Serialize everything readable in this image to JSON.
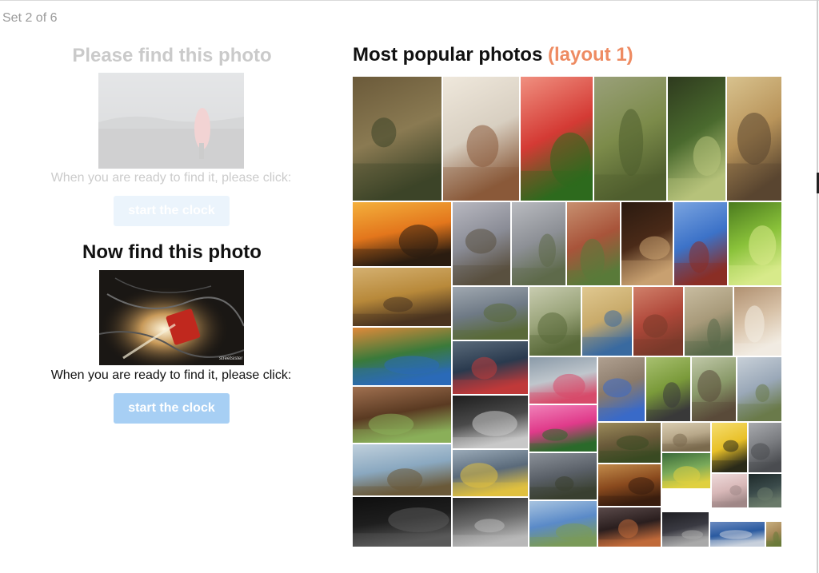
{
  "header": {
    "set_label": "Set 2 of 6"
  },
  "previous_target": {
    "heading": "Please find this photo",
    "instruction": "When you are ready to find it, please click:",
    "button_label": "start the clock",
    "image": "photo-misty-lake-silhouette"
  },
  "current_target": {
    "heading": "Now find this photo",
    "instruction": "When you are ready to find it, please click:",
    "button_label": "start the clock",
    "image": "photo-firefighters-night-scene",
    "watermark": "streetsister"
  },
  "gallery": {
    "title": "Most popular photos",
    "layout_label": "(layout 1)",
    "accent_color": "#ee8b62",
    "photos": [
      {
        "name": "tree-reflection-lake",
        "c1": "#8a7a52",
        "c2": "#3d4428",
        "c3": "#6b5a3a"
      },
      {
        "name": "woman-holding-hare",
        "c1": "#d8cfc1",
        "c2": "#8a5a3a",
        "c3": "#efe8dc"
      },
      {
        "name": "red-dahlia-flower",
        "c1": "#d43a34",
        "c2": "#2d6a1e",
        "c3": "#f09080"
      },
      {
        "name": "green-mountain-valley",
        "c1": "#7c8b4a",
        "c2": "#4f5e2e",
        "c3": "#9aa07a"
      },
      {
        "name": "palm-fronds-sky",
        "c1": "#4a6a2e",
        "c2": "#b6c27a",
        "c3": "#2e3a1e"
      },
      {
        "name": "sparrow-on-straw",
        "c1": "#b9945a",
        "c2": "#5a4630",
        "c3": "#d8c28e"
      },
      {
        "name": "sunset-gazebo",
        "c1": "#e3761c",
        "c2": "#2a1c10",
        "c3": "#f4b03c"
      },
      {
        "name": "beach-evening-people",
        "c1": "#8a8c96",
        "c2": "#5a5040",
        "c3": "#b8b8c0"
      },
      {
        "name": "grey-mountains-haze",
        "c1": "#8d9096",
        "c2": "#5e6a4a",
        "c3": "#b9bbc0"
      },
      {
        "name": "red-canyon-landscape",
        "c1": "#a8543a",
        "c2": "#5a7a3a",
        "c3": "#c79070"
      },
      {
        "name": "latte-art-coffee",
        "c1": "#4a2a18",
        "c2": "#c8a070",
        "c3": "#2a1a10"
      },
      {
        "name": "red-barn-blue-sky",
        "c1": "#3c72c8",
        "c2": "#8a2e26",
        "c3": "#7aa4e0"
      },
      {
        "name": "green-orchid",
        "c1": "#8ac23a",
        "c2": "#d8ea8a",
        "c3": "#4a7a1e"
      },
      {
        "name": "deer-in-grass",
        "c1": "#b8893a",
        "c2": "#4a3420",
        "c3": "#d4b070"
      },
      {
        "name": "castle-ruin-clouds",
        "c1": "#6f7a86",
        "c2": "#5a6a3a",
        "c3": "#a0a8b0"
      },
      {
        "name": "olive-trees-path",
        "c1": "#9aa47a",
        "c2": "#5a6a3a",
        "c3": "#c8ccb0"
      },
      {
        "name": "cafe-square-domes",
        "c1": "#c8aa6a",
        "c2": "#3a6aa0",
        "c3": "#e0c890"
      },
      {
        "name": "red-building-facade",
        "c1": "#b0483a",
        "c2": "#7a3a2a",
        "c3": "#d0806a"
      },
      {
        "name": "statue-garden-sepia",
        "c1": "#a89a7a",
        "c2": "#5a6a4a",
        "c3": "#c8bca0"
      },
      {
        "name": "glass-of-milk",
        "c1": "#d8c2a8",
        "c2": "#f2ece2",
        "c3": "#b09070"
      },
      {
        "name": "kingfisher-bird",
        "c1": "#3a7a3a",
        "c2": "#2a6ab8",
        "c3": "#e08a3a"
      },
      {
        "name": "light-painting-beach",
        "c1": "#2a3a4e",
        "c2": "#c03a3a",
        "c3": "#5a6a7a"
      },
      {
        "name": "pink-flamingos-flight",
        "c1": "#bfc6cc",
        "c2": "#d84a6a",
        "c3": "#8a9aa8"
      },
      {
        "name": "statue-balloons-square",
        "c1": "#8a7a6a",
        "c2": "#3a6ac8",
        "c3": "#b0a090"
      },
      {
        "name": "barnacle-goose",
        "c1": "#7a9a3a",
        "c2": "#3a3a3a",
        "c3": "#a8c070"
      },
      {
        "name": "marmot-rocks",
        "c1": "#8a9a6a",
        "c2": "#5a4a3a",
        "c3": "#c0c8a8"
      },
      {
        "name": "tower-on-hill",
        "c1": "#9aa8b8",
        "c2": "#6a7a4a",
        "c3": "#c8d0d8"
      },
      {
        "name": "two-donkeys",
        "c1": "#5a3a22",
        "c2": "#8ab05a",
        "c3": "#a07050"
      },
      {
        "name": "bw-interior-window",
        "c1": "#4a4a4a",
        "c2": "#c8c8c8",
        "c3": "#1e1e1e"
      },
      {
        "name": "pink-cosmos-flower",
        "c1": "#e03a8a",
        "c2": "#2a6a2a",
        "c3": "#f080b8"
      },
      {
        "name": "mushrooms-forest-floor",
        "c1": "#6a5a3a",
        "c2": "#3a4a22",
        "c3": "#9a8a5a"
      },
      {
        "name": "running-goat",
        "c1": "#b8a88a",
        "c2": "#7a6a4e",
        "c3": "#d8ccb0"
      },
      {
        "name": "fly-on-yellow",
        "c1": "#e8c028",
        "c2": "#2a2a1a",
        "c3": "#f6de70"
      },
      {
        "name": "calm-sea-horizon",
        "c1": "#7a7c80",
        "c2": "#4a4c50",
        "c3": "#a8aaae"
      },
      {
        "name": "coastal-rocks-sea",
        "c1": "#8aa8c0",
        "c2": "#6a5a3a",
        "c3": "#c0d0dc"
      },
      {
        "name": "person-megaphone",
        "c1": "#5a6a7a",
        "c2": "#e0c040",
        "c3": "#9aaab8"
      },
      {
        "name": "dark-hills-stormy",
        "c1": "#5a6068",
        "c2": "#3a4030",
        "c3": "#8a9098"
      },
      {
        "name": "church-interior-arches",
        "c1": "#8a4a1e",
        "c2": "#3a1e0e",
        "c3": "#c08a4a"
      },
      {
        "name": "blue-tit-bird",
        "c1": "#7aaa5a",
        "c2": "#e0d040",
        "c3": "#3a6a3a"
      },
      {
        "name": "pink-wall-shadow",
        "c1": "#d8b8b8",
        "c2": "#a08888",
        "c3": "#eedada"
      },
      {
        "name": "iguana-lizard",
        "c1": "#3a4a4a",
        "c2": "#6a7a6a",
        "c3": "#1e2a2a"
      },
      {
        "name": "boy-portrait-bw",
        "c1": "#1e1e1e",
        "c2": "#5a5a5a",
        "c3": "#0e0e0e"
      },
      {
        "name": "abandoned-car-bw",
        "c1": "#6a6a6a",
        "c2": "#b8b8b8",
        "c3": "#2a2a2a"
      },
      {
        "name": "pier-lake-sunny",
        "c1": "#5a8ac8",
        "c2": "#7a9a5a",
        "c3": "#a8c4e0"
      },
      {
        "name": "night-sparks",
        "c1": "#2a1e1e",
        "c2": "#c06a3a",
        "c3": "#5a4a4a"
      },
      {
        "name": "man-in-dark-light",
        "c1": "#3a3a42",
        "c2": "#aaaaaa",
        "c3": "#1e1e22"
      },
      {
        "name": "blue-ocean-cliff",
        "c1": "#2a5aa0",
        "c2": "#c8d0dc",
        "c3": "#6a8ac0"
      },
      {
        "name": "horse-field",
        "c1": "#a88a5a",
        "c2": "#6a7a3a",
        "c3": "#c8b080"
      }
    ]
  }
}
